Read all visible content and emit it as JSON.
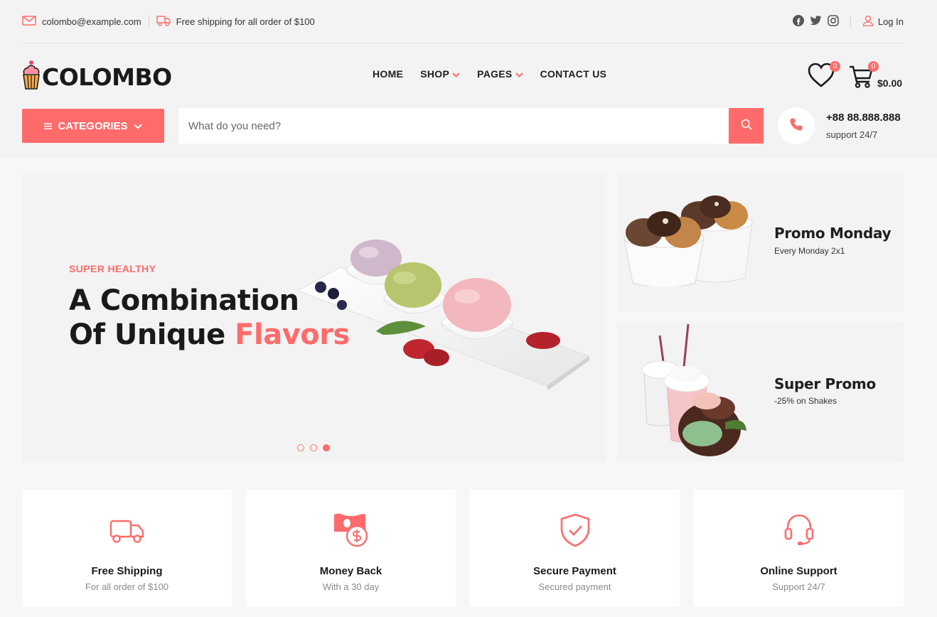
{
  "topbar": {
    "email": "colombo@example.com",
    "shipping_note": "Free shipping for all order of $100",
    "login_label": "Log In",
    "social_icons": [
      "facebook-icon",
      "twitter-icon",
      "instagram-icon"
    ]
  },
  "brand": {
    "name": "COLOMBO",
    "accent_color": "#ff6b6b"
  },
  "nav": {
    "home": "HOME",
    "shop": "SHOP",
    "pages": "PAGES",
    "contact": "CONTACT US"
  },
  "header_icons": {
    "wishlist_count": "0",
    "cart_count": "0",
    "cart_total": "$0.00"
  },
  "categories_label": "CATEGORIES",
  "search": {
    "placeholder": "What do you need?"
  },
  "phone": {
    "number": "+88 88.888.888",
    "support": "support 24/7"
  },
  "hero": {
    "tag": "SUPER HEALTHY",
    "title_line1": "A Combination",
    "title_line2_prefix": "Of Unique ",
    "title_line2_accent": "Flavors",
    "slides": 3,
    "active_slide": 3
  },
  "promos": [
    {
      "title": "Promo Monday",
      "subtitle": "Every Monday 2x1"
    },
    {
      "title": "Super Promo",
      "subtitle": "-25% on Shakes"
    }
  ],
  "features": [
    {
      "title": "Free Shipping",
      "subtitle": "For all order of $100",
      "icon": "truck-icon"
    },
    {
      "title": "Money Back",
      "subtitle": "With a 30 day",
      "icon": "money-back-icon"
    },
    {
      "title": "Secure Payment",
      "subtitle": "Secured payment",
      "icon": "shield-check-icon"
    },
    {
      "title": "Online Support",
      "subtitle": "Support 24/7",
      "icon": "headset-icon"
    }
  ]
}
